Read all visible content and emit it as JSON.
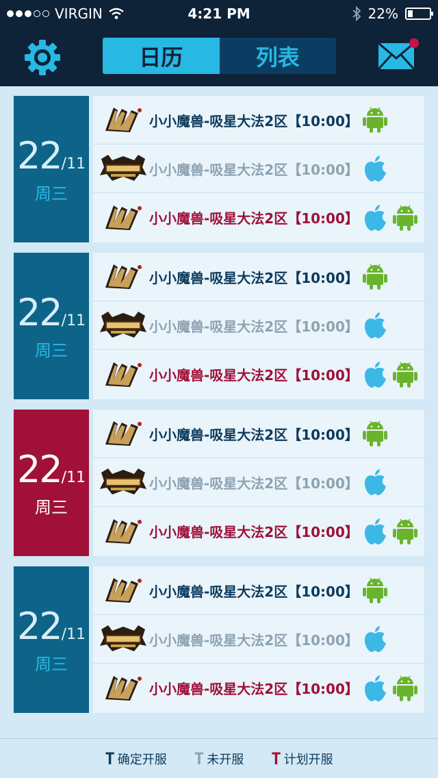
{
  "status_bar": {
    "carrier": "VIRGIN",
    "time": "4:21 PM",
    "battery": "22%",
    "battery_level": 0.22,
    "icons": [
      "signal-dots",
      "wifi-icon",
      "bluetooth-icon",
      "battery-icon"
    ]
  },
  "nav": {
    "settings_icon": "gear-icon",
    "tabs": [
      {
        "label": "日历",
        "active": true
      },
      {
        "label": "列表",
        "active": false
      }
    ],
    "mail_icon": "mail-icon",
    "mail_badge": true
  },
  "colors": {
    "header_bg": "#0e2238",
    "accent_cyan": "#27b8e4",
    "date_blue": "#0d6488",
    "date_red": "#a01038",
    "confirmed_text": "#0d3a5c",
    "unopened_text": "#8ea3b1",
    "planned_text": "#a01038",
    "android_green": "#6ab42d",
    "apple_blue": "#3cb8e6"
  },
  "days": [
    {
      "day": "22",
      "month": "/11",
      "weekday": "周三",
      "highlight": false,
      "entries": [
        {
          "logo": "game-logo-a",
          "name": "小小魔兽",
          "server": "-吸星大法2区",
          "time": "【10:00】",
          "status": "confirmed",
          "platforms": [
            "android"
          ]
        },
        {
          "logo": "game-logo-b",
          "name": "小小魔兽",
          "server": "-吸星大法2区",
          "time": "【10:00】",
          "status": "unopened",
          "platforms": [
            "apple"
          ]
        },
        {
          "logo": "game-logo-a",
          "name": "小小魔兽",
          "server": "-吸星大法2区",
          "time": "【10:00】",
          "status": "planned",
          "platforms": [
            "apple",
            "android"
          ]
        }
      ]
    },
    {
      "day": "22",
      "month": "/11",
      "weekday": "周三",
      "highlight": false,
      "entries": [
        {
          "logo": "game-logo-a",
          "name": "小小魔兽",
          "server": "-吸星大法2区",
          "time": "【10:00】",
          "status": "confirmed",
          "platforms": [
            "android"
          ]
        },
        {
          "logo": "game-logo-b",
          "name": "小小魔兽",
          "server": "-吸星大法2区",
          "time": "【10:00】",
          "status": "unopened",
          "platforms": [
            "apple"
          ]
        },
        {
          "logo": "game-logo-a",
          "name": "小小魔兽",
          "server": "-吸星大法2区",
          "time": "【10:00】",
          "status": "planned",
          "platforms": [
            "apple",
            "android"
          ]
        }
      ]
    },
    {
      "day": "22",
      "month": "/11",
      "weekday": "周三",
      "highlight": true,
      "entries": [
        {
          "logo": "game-logo-a",
          "name": "小小魔兽",
          "server": "-吸星大法2区",
          "time": "【10:00】",
          "status": "confirmed",
          "platforms": [
            "android"
          ]
        },
        {
          "logo": "game-logo-b",
          "name": "小小魔兽",
          "server": "-吸星大法2区",
          "time": "【10:00】",
          "status": "unopened",
          "platforms": [
            "apple"
          ]
        },
        {
          "logo": "game-logo-a",
          "name": "小小魔兽",
          "server": "-吸星大法2区",
          "time": "【10:00】",
          "status": "planned",
          "platforms": [
            "apple",
            "android"
          ]
        }
      ]
    },
    {
      "day": "22",
      "month": "/11",
      "weekday": "周三",
      "highlight": false,
      "entries": [
        {
          "logo": "game-logo-a",
          "name": "小小魔兽",
          "server": "-吸星大法2区",
          "time": "【10:00】",
          "status": "confirmed",
          "platforms": [
            "android"
          ]
        },
        {
          "logo": "game-logo-b",
          "name": "小小魔兽",
          "server": "-吸星大法2区",
          "time": "【10:00】",
          "status": "unopened",
          "platforms": [
            "apple"
          ]
        },
        {
          "logo": "game-logo-a",
          "name": "小小魔兽",
          "server": "-吸星大法2区",
          "time": "【10:00】",
          "status": "planned",
          "platforms": [
            "apple",
            "android"
          ]
        }
      ]
    }
  ],
  "legend": [
    {
      "mark": "T",
      "label": "确定开服",
      "status": "confirmed"
    },
    {
      "mark": "T",
      "label": "未开服",
      "status": "unopened"
    },
    {
      "mark": "T",
      "label": "计划开服",
      "status": "planned"
    }
  ]
}
